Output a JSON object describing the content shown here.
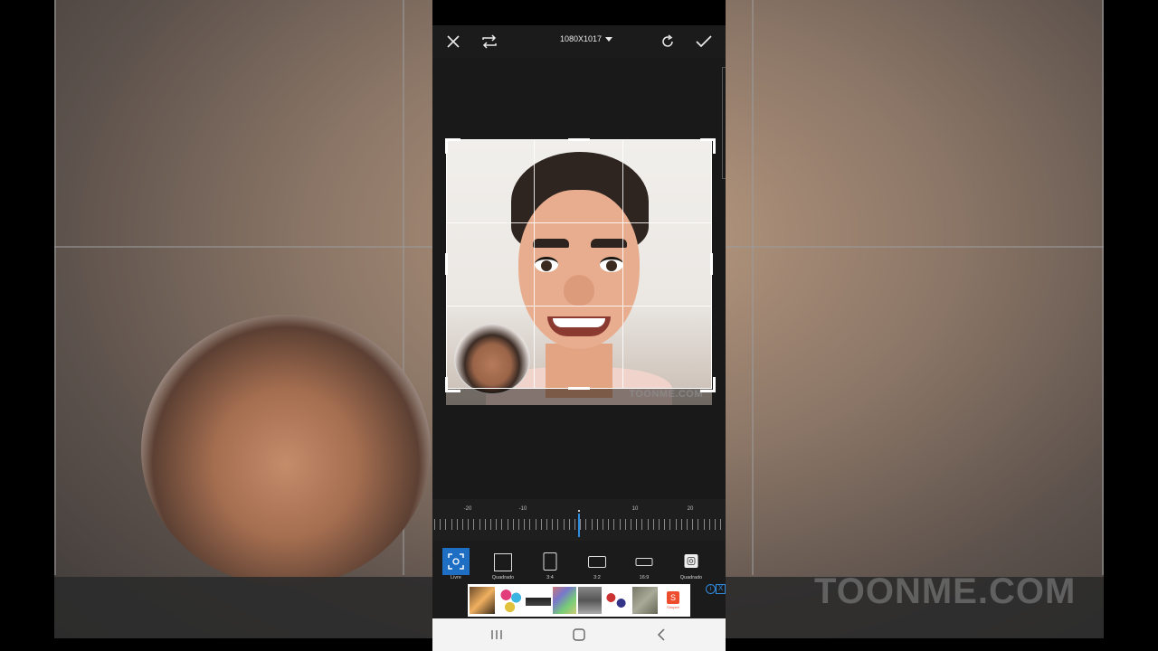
{
  "topbar": {
    "size_label": "1080X1017",
    "icons": [
      "close-icon",
      "swap-icon",
      "rotate-icon",
      "check-icon"
    ]
  },
  "ruler": {
    "labels": [
      "-20",
      "-10",
      "0",
      "10",
      "20"
    ],
    "value": 0
  },
  "ratios": [
    {
      "label": "Livre",
      "active": true
    },
    {
      "label": "Quadrado",
      "active": false
    },
    {
      "label": "3:4",
      "active": false
    },
    {
      "label": "3:2",
      "active": false
    },
    {
      "label": "16:9",
      "active": false
    },
    {
      "label": "Quadrado",
      "active": false
    }
  ],
  "photo": {
    "watermark": "TOONME.COM"
  },
  "background": {
    "watermark": "TOONME.COM"
  },
  "ad": {
    "info_icon": "i",
    "close_icon": "X",
    "brand": "Shopee"
  },
  "colors": {
    "accent": "#2f8be0",
    "active_ratio": "#1e6fc4",
    "toolbar_bg": "#1b1b1b"
  }
}
